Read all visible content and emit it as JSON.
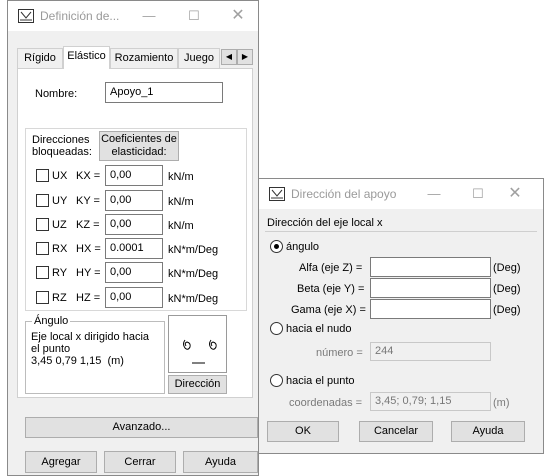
{
  "left_dialog": {
    "title": "Definición de...",
    "tabs": [
      "Rígido",
      "Elástico",
      "Rozamiento",
      "Juego"
    ],
    "name_label": "Nombre:",
    "name_value": "Apoyo_1",
    "dir_bloq_label": "Direcciones\nbloqueadas:",
    "coef_button": "Coeficientes de\nelasticidad:",
    "rows": [
      {
        "dof": "UX",
        "coef": "KX =",
        "value": "0,00",
        "unit": "kN/m"
      },
      {
        "dof": "UY",
        "coef": "KY =",
        "value": "0,00",
        "unit": "kN/m"
      },
      {
        "dof": "UZ",
        "coef": "KZ =",
        "value": "0,00",
        "unit": "kN/m"
      },
      {
        "dof": "RX",
        "coef": "HX =",
        "value": "0.0001",
        "unit": "kN*m/Deg"
      },
      {
        "dof": "RY",
        "coef": "HY =",
        "value": "0,00",
        "unit": "kN*m/Deg"
      },
      {
        "dof": "RZ",
        "coef": "HZ =",
        "value": "0,00",
        "unit": "kN*m/Deg"
      }
    ],
    "angle_group_label": "Ángulo",
    "angle_text": "Eje local x dirigido hacia\nel punto\n3,45 0,79 1,15  (m)",
    "direction_button": "Dirección",
    "advanced_button": "Avanzado...",
    "add_button": "Agregar",
    "close_button": "Cerrar",
    "help_button": "Ayuda"
  },
  "right_dialog": {
    "title": "Dirección del apoyo",
    "group_label": "Dirección del eje local x",
    "angle_radio": "ángulo",
    "alfa_label": "Alfa (eje Z) =",
    "beta_label": "Beta (eje Y) =",
    "gama_label": "Gama (eje X) =",
    "deg_unit": "(Deg)",
    "node_radio": "hacia el nudo",
    "number_label": "número =",
    "number_value": "244",
    "point_radio": "hacia el punto",
    "coords_label": "coordenadas =",
    "coords_value": "3,45; 0,79; 1,15",
    "m_unit": "(m)",
    "ok_button": "OK",
    "cancel_button": "Cancelar",
    "help_button": "Ayuda"
  }
}
